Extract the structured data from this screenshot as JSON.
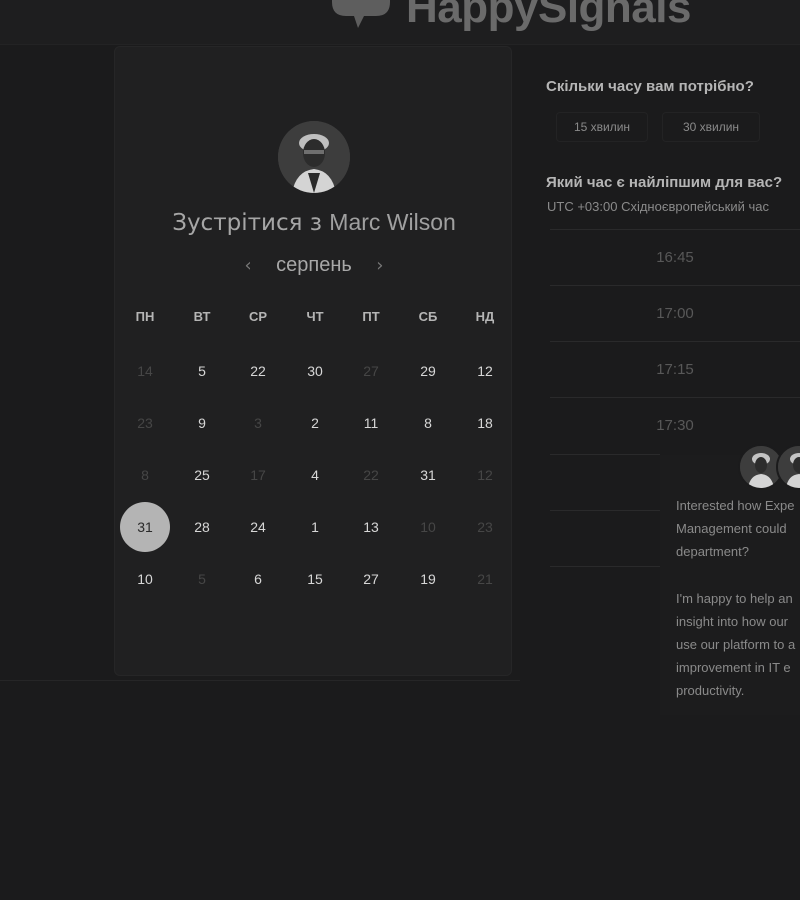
{
  "brand": {
    "name": "HappySignals"
  },
  "calendar": {
    "title_prefix": "Зустрітися з",
    "host_name": "Marc Wilson",
    "month": "серпень",
    "prev_label": "‹",
    "next_label": "›",
    "weekdays": [
      "ПН",
      "ВТ",
      "СР",
      "ЧТ",
      "ПТ",
      "СБ",
      "НД"
    ],
    "weeks": [
      [
        {
          "d": "14",
          "m": true
        },
        {
          "d": "5",
          "m": false
        },
        {
          "d": "22",
          "m": false
        },
        {
          "d": "30",
          "m": false
        },
        {
          "d": "27",
          "m": true
        },
        {
          "d": "29",
          "m": false
        },
        {
          "d": "12",
          "m": false
        }
      ],
      [
        {
          "d": "23",
          "m": true
        },
        {
          "d": "9",
          "m": false
        },
        {
          "d": "3",
          "m": true
        },
        {
          "d": "2",
          "m": false
        },
        {
          "d": "11",
          "m": false
        },
        {
          "d": "8",
          "m": false
        },
        {
          "d": "18",
          "m": false
        }
      ],
      [
        {
          "d": "8",
          "m": true
        },
        {
          "d": "25",
          "m": false
        },
        {
          "d": "17",
          "m": true
        },
        {
          "d": "4",
          "m": false
        },
        {
          "d": "22",
          "m": true
        },
        {
          "d": "31",
          "m": false
        },
        {
          "d": "12",
          "m": true
        }
      ],
      [
        {
          "d": "31",
          "m": false,
          "s": true
        },
        {
          "d": "28",
          "m": false
        },
        {
          "d": "24",
          "m": false
        },
        {
          "d": "1",
          "m": false
        },
        {
          "d": "13",
          "m": false
        },
        {
          "d": "10",
          "m": true
        },
        {
          "d": "23",
          "m": true
        }
      ],
      [
        {
          "d": "10",
          "m": false
        },
        {
          "d": "5",
          "m": true
        },
        {
          "d": "6",
          "m": false
        },
        {
          "d": "15",
          "m": false
        },
        {
          "d": "27",
          "m": false
        },
        {
          "d": "19",
          "m": false
        },
        {
          "d": "21",
          "m": true
        }
      ]
    ]
  },
  "duration": {
    "question": "Скільки часу вам потрібно?",
    "options": [
      "15 хвилин",
      "30 хвилин"
    ]
  },
  "timeslots": {
    "question": "Який час є найліпшим для вас?",
    "timezone": "UTC +03:00 Східноєвропейський час",
    "slots": [
      "16:45",
      "17:00",
      "17:15",
      "17:30"
    ]
  },
  "chat": {
    "lines": [
      "Interested how Expe",
      "Management could",
      "department?",
      "",
      "I'm happy to help an",
      "insight into how our",
      "use our platform to a",
      "improvement in IT e",
      "productivity."
    ]
  },
  "colors": {
    "background": "#1b1b1c",
    "card": "#202021",
    "selected_day": "#b4b4b4"
  }
}
